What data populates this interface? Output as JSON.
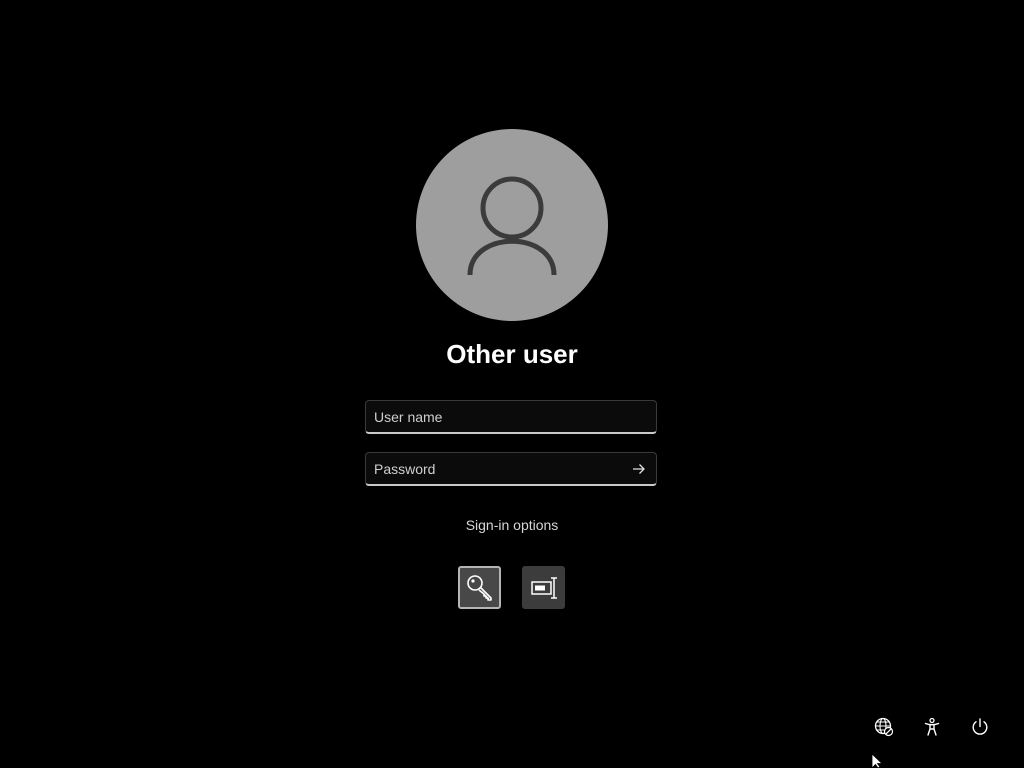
{
  "login": {
    "user_title": "Other user",
    "avatar_icon": "user-silhouette-icon",
    "username": {
      "placeholder": "User name",
      "value": ""
    },
    "password": {
      "placeholder": "Password",
      "value": "",
      "submit_icon": "arrow-right-icon"
    },
    "signin_options_label": "Sign-in options",
    "options": [
      {
        "icon": "password-key-icon",
        "selected": true
      },
      {
        "icon": "smart-card-icon",
        "selected": false
      }
    ]
  },
  "system_tray": {
    "icons": [
      "network-icon",
      "accessibility-icon",
      "power-icon"
    ]
  },
  "colors": {
    "background": "#000000",
    "avatar_circle": "#9e9e9e",
    "avatar_figure": "#3b3b3b",
    "text_primary": "#ffffff",
    "text_secondary": "#d6d6d6",
    "field_background": "#0b0b0b",
    "field_underline": "#c9c9c9",
    "tile_background": "#3c3c3c"
  }
}
